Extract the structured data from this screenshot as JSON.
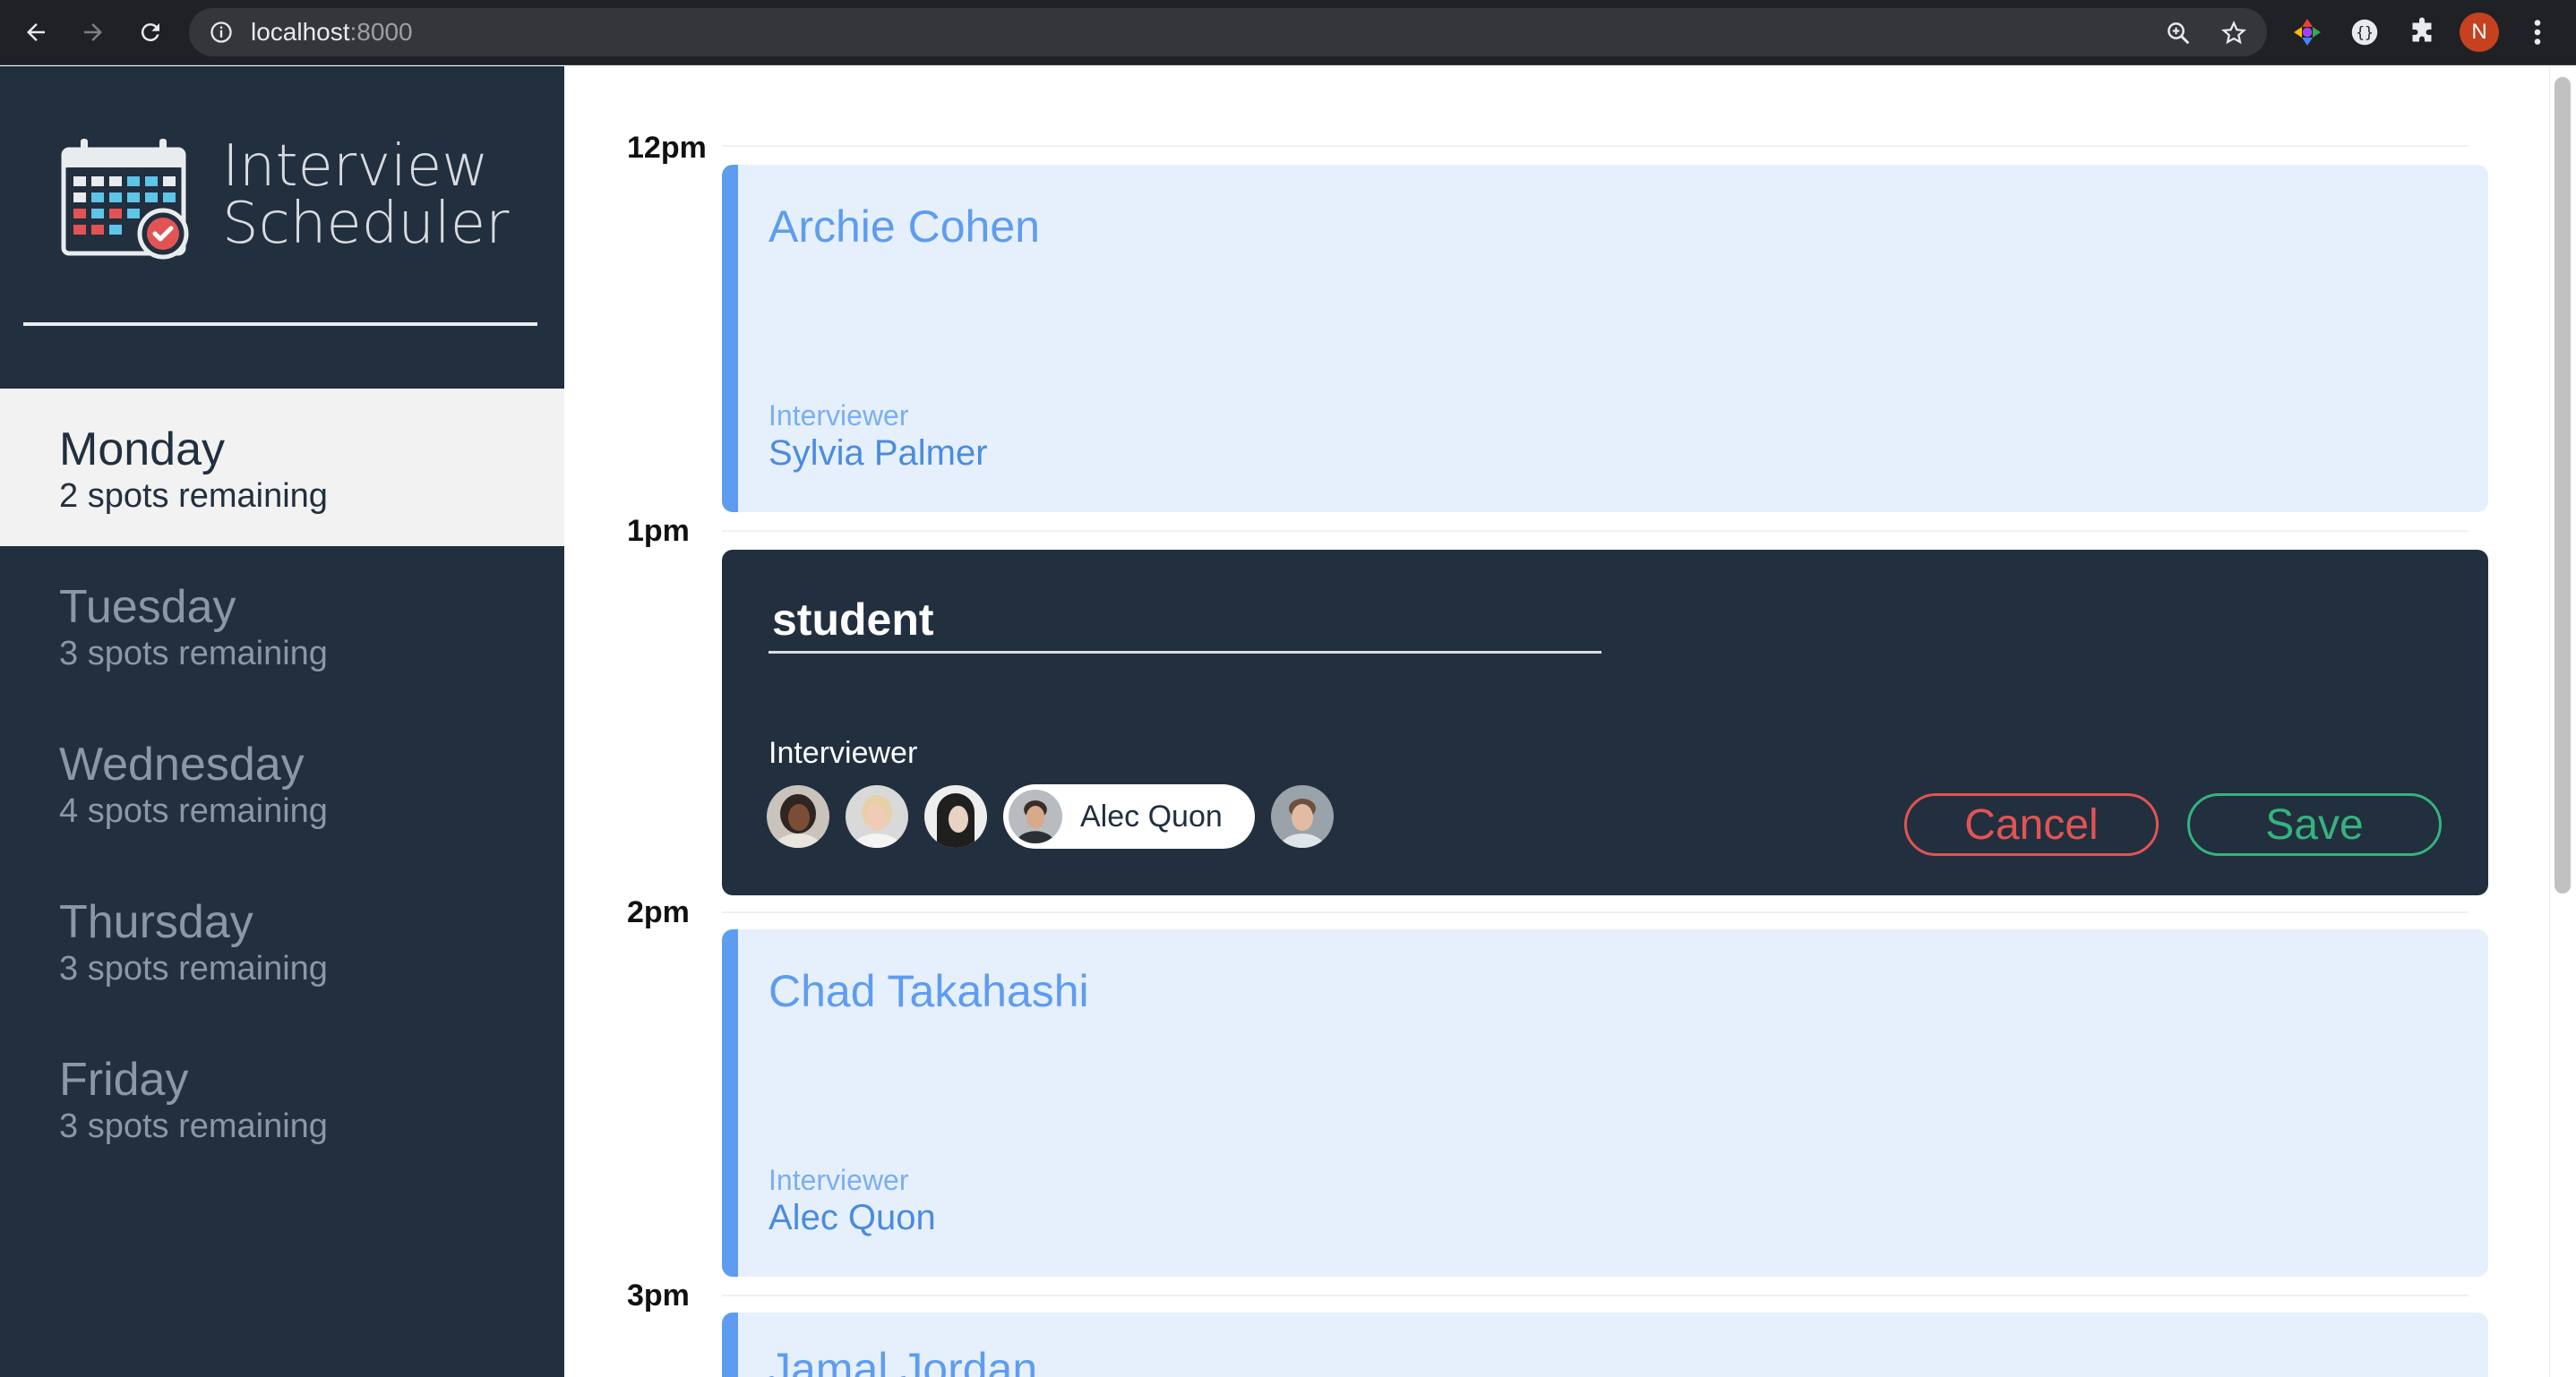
{
  "browser": {
    "url_host": "localhost",
    "url_port": ":8000",
    "profile_initial": "N"
  },
  "sidebar": {
    "logo_line1": "Interview",
    "logo_line2": "Scheduler",
    "days": [
      {
        "name": "Monday",
        "spots": "2 spots remaining",
        "selected": true
      },
      {
        "name": "Tuesday",
        "spots": "3 spots remaining",
        "selected": false
      },
      {
        "name": "Wednesday",
        "spots": "4 spots remaining",
        "selected": false
      },
      {
        "name": "Thursday",
        "spots": "3 spots remaining",
        "selected": false
      },
      {
        "name": "Friday",
        "spots": "3 spots remaining",
        "selected": false
      }
    ]
  },
  "schedule": {
    "times": [
      "12pm",
      "1pm",
      "2pm",
      "3pm"
    ],
    "appointments": [
      {
        "student": "Archie Cohen",
        "interviewer_label": "Interviewer",
        "interviewer": "Sylvia Palmer"
      },
      {
        "student": "Chad Takahashi",
        "interviewer_label": "Interviewer",
        "interviewer": "Alec Quon"
      },
      {
        "student": "Jamal Jordan"
      }
    ],
    "form": {
      "student_value": "student",
      "interviewer_label": "Interviewer",
      "selected_interviewer": "Alec Quon",
      "cancel_label": "Cancel",
      "save_label": "Save"
    }
  },
  "colors": {
    "sidebar_bg": "#222f3e",
    "appointment_bg": "#e6f0fd",
    "appointment_accent": "#5e9cf1",
    "cancel": "#e25454",
    "save": "#35b37e"
  }
}
